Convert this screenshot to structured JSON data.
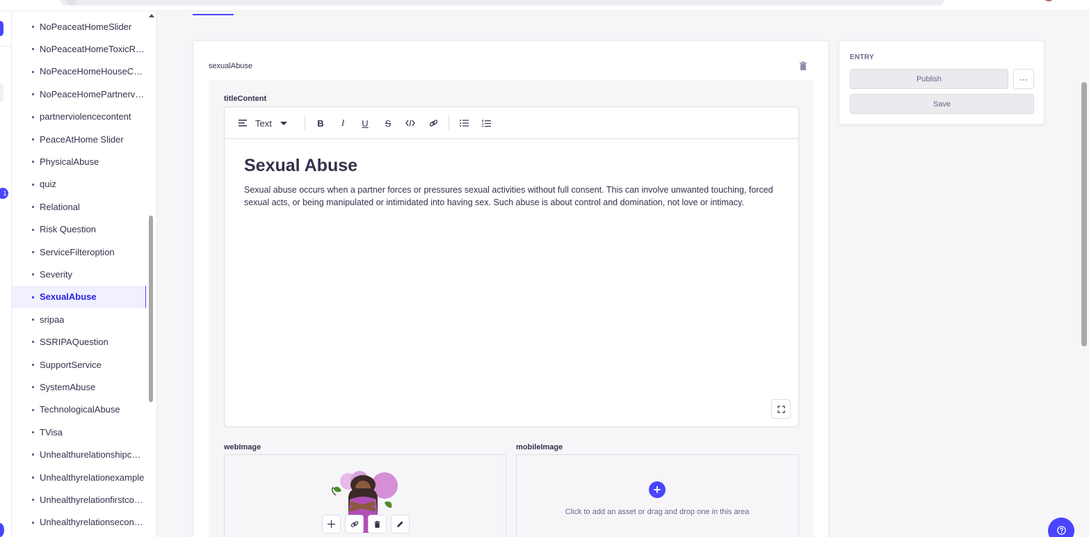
{
  "sidebar": {
    "items": [
      {
        "label": "NoPeaceatHomeSlider"
      },
      {
        "label": "NoPeaceatHomeToxicRela..."
      },
      {
        "label": "NoPeaceHomeHouseCon..."
      },
      {
        "label": "NoPeaceHomePartnerviol..."
      },
      {
        "label": "partnerviolencecontent"
      },
      {
        "label": "PeaceAtHome Slider"
      },
      {
        "label": "PhysicalAbuse"
      },
      {
        "label": "quiz"
      },
      {
        "label": "Relational"
      },
      {
        "label": "Risk Question"
      },
      {
        "label": "ServiceFilteroption"
      },
      {
        "label": "Severity"
      },
      {
        "label": "SexualAbuse",
        "active": true
      },
      {
        "label": "sripaa"
      },
      {
        "label": "SSRIPAQuestion"
      },
      {
        "label": "SupportService"
      },
      {
        "label": "SystemAbuse"
      },
      {
        "label": "TechnologicalAbuse"
      },
      {
        "label": "TVisa"
      },
      {
        "label": "Unhealthurelationshipcon..."
      },
      {
        "label": "Unhealthyrelationexample"
      },
      {
        "label": "Unhealthyrelationfirstcon..."
      },
      {
        "label": "Unhealthyrelationsecond..."
      }
    ]
  },
  "mainnav": {
    "notification_count": "1"
  },
  "component": {
    "name": "sexualAbuse",
    "title_field_label": "titleContent",
    "toolbar": {
      "block_type": "Text"
    },
    "editor": {
      "heading": "Sexual Abuse",
      "paragraph": "Sexual abuse occurs when a partner forces or pressures sexual activities without full consent. This can involve unwanted touching, forced sexual acts, or being manipulated or intimidated into having sex. Such abuse is about control and domination, not love or intimacy."
    },
    "web_image_label": "webImage",
    "mobile_image_label": "mobileImage",
    "mobile_image_hint": "Click to add an asset or drag and drop one in this area"
  },
  "right_panel": {
    "section_label": "ENTRY",
    "publish_label": "Publish",
    "more_label": "···",
    "save_label": "Save"
  },
  "colors": {
    "primary": "#4945ff",
    "text": "#32324d",
    "muted": "#666687",
    "border": "#dcdce4"
  }
}
